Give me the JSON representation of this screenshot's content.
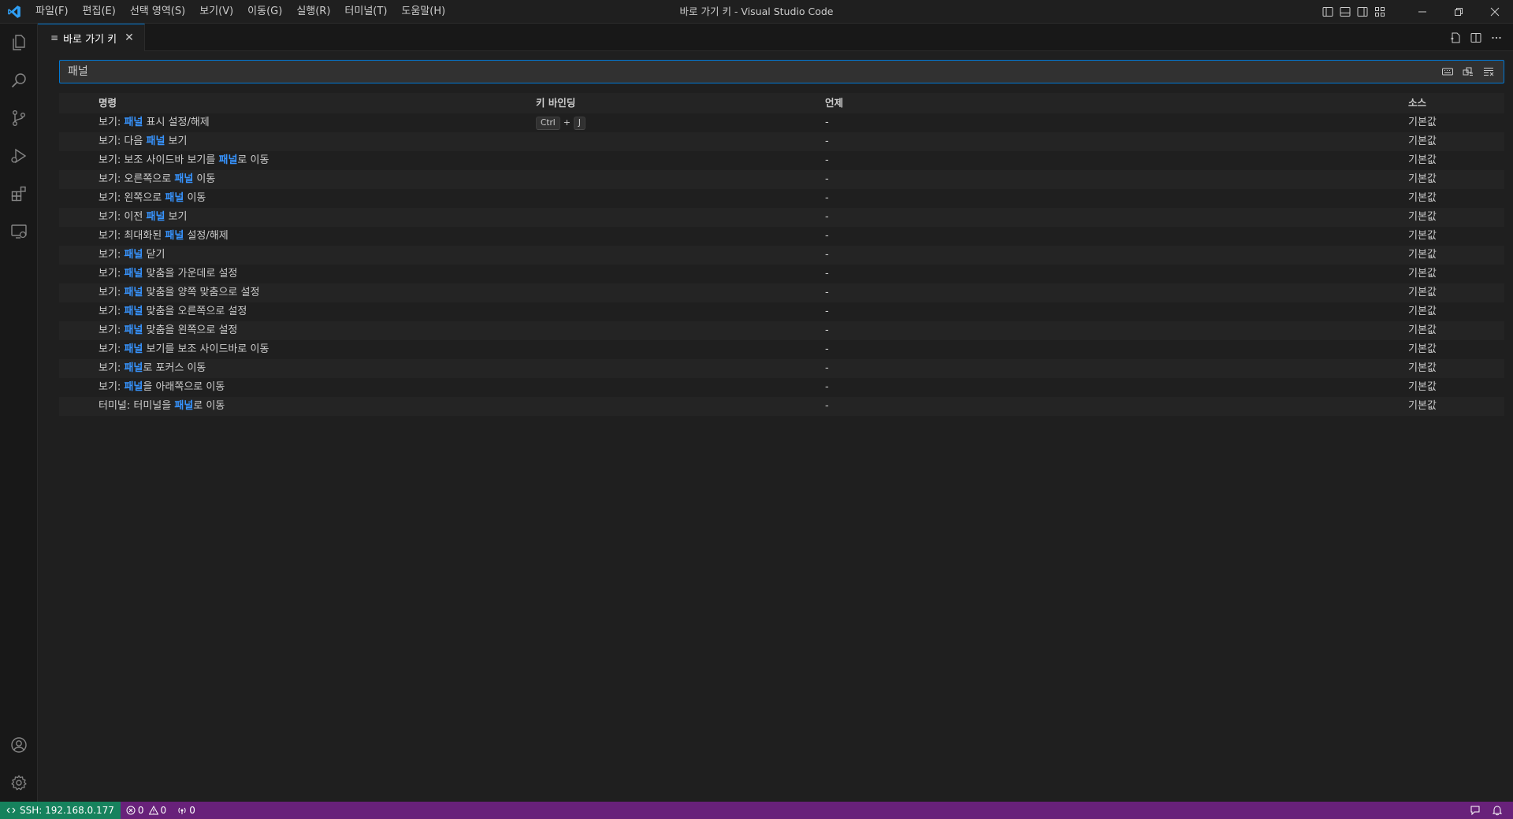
{
  "window": {
    "title": "바로 가기 키 - Visual Studio Code"
  },
  "menu": [
    {
      "label": "파일(F)"
    },
    {
      "label": "편집(E)"
    },
    {
      "label": "선택 영역(S)"
    },
    {
      "label": "보기(V)"
    },
    {
      "label": "이동(G)"
    },
    {
      "label": "실행(R)"
    },
    {
      "label": "터미널(T)"
    },
    {
      "label": "도움말(H)"
    }
  ],
  "tab": {
    "label": "바로 가기 키",
    "icon": "keybindings-icon"
  },
  "search": {
    "value": "패널"
  },
  "table": {
    "headers": {
      "command": "명령",
      "keybinding": "키 바인딩",
      "when": "언제",
      "source": "소스"
    },
    "rows": [
      {
        "pre": "보기: ",
        "hl": "패널",
        "post": " 표시 설정/해제",
        "keys": [
          "Ctrl",
          "J"
        ],
        "when": "-",
        "source": "기본값"
      },
      {
        "pre": "보기: 다음 ",
        "hl": "패널",
        "post": " 보기",
        "keys": [],
        "when": "-",
        "source": "기본값"
      },
      {
        "pre": "보기: 보조 사이드바 보기를 ",
        "hl": "패널",
        "post": "로 이동",
        "keys": [],
        "when": "-",
        "source": "기본값"
      },
      {
        "pre": "보기: 오른쪽으로 ",
        "hl": "패널",
        "post": " 이동",
        "keys": [],
        "when": "-",
        "source": "기본값"
      },
      {
        "pre": "보기: 왼쪽으로 ",
        "hl": "패널",
        "post": " 이동",
        "keys": [],
        "when": "-",
        "source": "기본값"
      },
      {
        "pre": "보기: 이전 ",
        "hl": "패널",
        "post": " 보기",
        "keys": [],
        "when": "-",
        "source": "기본값"
      },
      {
        "pre": "보기: 최대화된 ",
        "hl": "패널",
        "post": " 설정/해제",
        "keys": [],
        "when": "-",
        "source": "기본값"
      },
      {
        "pre": "보기: ",
        "hl": "패널",
        "post": " 닫기",
        "keys": [],
        "when": "-",
        "source": "기본값"
      },
      {
        "pre": "보기: ",
        "hl": "패널",
        "post": " 맞춤을 가운데로 설정",
        "keys": [],
        "when": "-",
        "source": "기본값"
      },
      {
        "pre": "보기: ",
        "hl": "패널",
        "post": " 맞춤을 양쪽 맞춤으로 설정",
        "keys": [],
        "when": "-",
        "source": "기본값"
      },
      {
        "pre": "보기: ",
        "hl": "패널",
        "post": " 맞춤을 오른쪽으로 설정",
        "keys": [],
        "when": "-",
        "source": "기본값"
      },
      {
        "pre": "보기: ",
        "hl": "패널",
        "post": " 맞춤을 왼쪽으로 설정",
        "keys": [],
        "when": "-",
        "source": "기본값"
      },
      {
        "pre": "보기: ",
        "hl": "패널",
        "post": " 보기를 보조 사이드바로 이동",
        "keys": [],
        "when": "-",
        "source": "기본값"
      },
      {
        "pre": "보기: ",
        "hl": "패널",
        "post": "로 포커스 이동",
        "keys": [],
        "when": "-",
        "source": "기본값"
      },
      {
        "pre": "보기: ",
        "hl": "패널",
        "post": "을 아래쪽으로 이동",
        "keys": [],
        "when": "-",
        "source": "기본값"
      },
      {
        "pre": "터미널: 터미널을 ",
        "hl": "패널",
        "post": "로 이동",
        "keys": [],
        "when": "-",
        "source": "기본값"
      }
    ]
  },
  "statusbar": {
    "remote": "SSH: 192.168.0.177",
    "errors": "0",
    "warnings": "0",
    "ports": "0"
  },
  "colors": {
    "accent": "#0078d4",
    "highlight": "#3794ff",
    "statusbar": "#68217a",
    "remote": "#16825d"
  }
}
